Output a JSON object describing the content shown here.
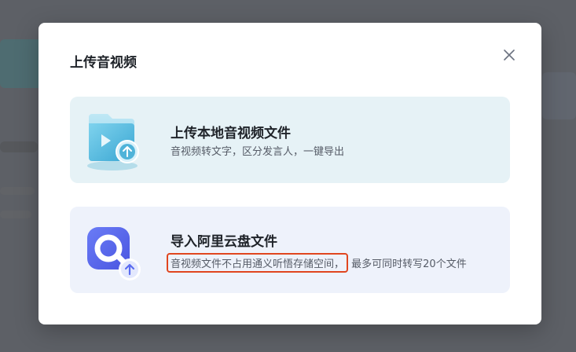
{
  "dialog": {
    "title": "上传音视频",
    "close_icon": "close-icon"
  },
  "options": {
    "local": {
      "title": "上传本地音视频文件",
      "description": "音视频转文字，区分发言人，一键导出",
      "icon": "folder-upload-icon",
      "accent": "#4fb3d9"
    },
    "cloud": {
      "title": "导入阿里云盘文件",
      "description_highlight": "音视频文件不占用通义听悟存储空间，",
      "description_rest": "最多可同时转写20个文件",
      "icon": "aliyun-drive-upload-icon",
      "accent": "#5b6cf0",
      "highlight_color": "#e0461f"
    }
  }
}
